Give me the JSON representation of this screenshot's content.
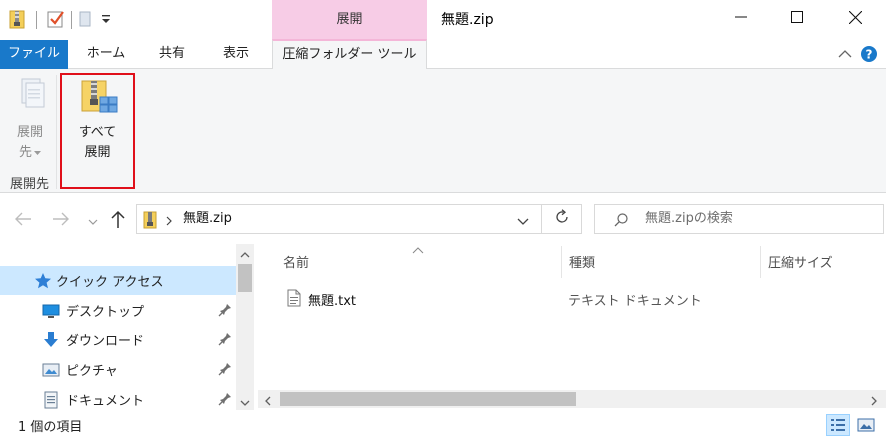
{
  "window": {
    "title": "無題.zip",
    "context_tab_header": "展開"
  },
  "tabs": {
    "file": "ファイル",
    "home": "ホーム",
    "share": "共有",
    "view": "表示",
    "compressed_tools": "圧縮フォルダー ツール"
  },
  "ribbon": {
    "extract_to_line1": "展開",
    "extract_to_line2": "先",
    "extract_all_line1": "すべて",
    "extract_all_line2": "展開",
    "group_label": "展開先"
  },
  "address": {
    "path": "無題.zip",
    "search_placeholder": "無題.zipの検索"
  },
  "nav": {
    "items": [
      {
        "label": "クイック アクセス",
        "icon": "star-icon"
      },
      {
        "label": "デスクトップ",
        "icon": "desktop-icon"
      },
      {
        "label": "ダウンロード",
        "icon": "download-arrow-icon"
      },
      {
        "label": "ピクチャ",
        "icon": "pictures-icon"
      },
      {
        "label": "ドキュメント",
        "icon": "documents-icon"
      }
    ]
  },
  "columns": {
    "name": "名前",
    "type": "種類",
    "compressed_size": "圧縮サイズ"
  },
  "files": [
    {
      "name": "無題.txt",
      "type": "テキスト ドキュメント"
    }
  ],
  "status": {
    "item_count": "1 個の項目"
  },
  "colors": {
    "file_tab": "#1979ca",
    "context_tab": "#f7cce6",
    "highlight_box": "#e0101a",
    "selected_nav": "#cce8ff"
  }
}
